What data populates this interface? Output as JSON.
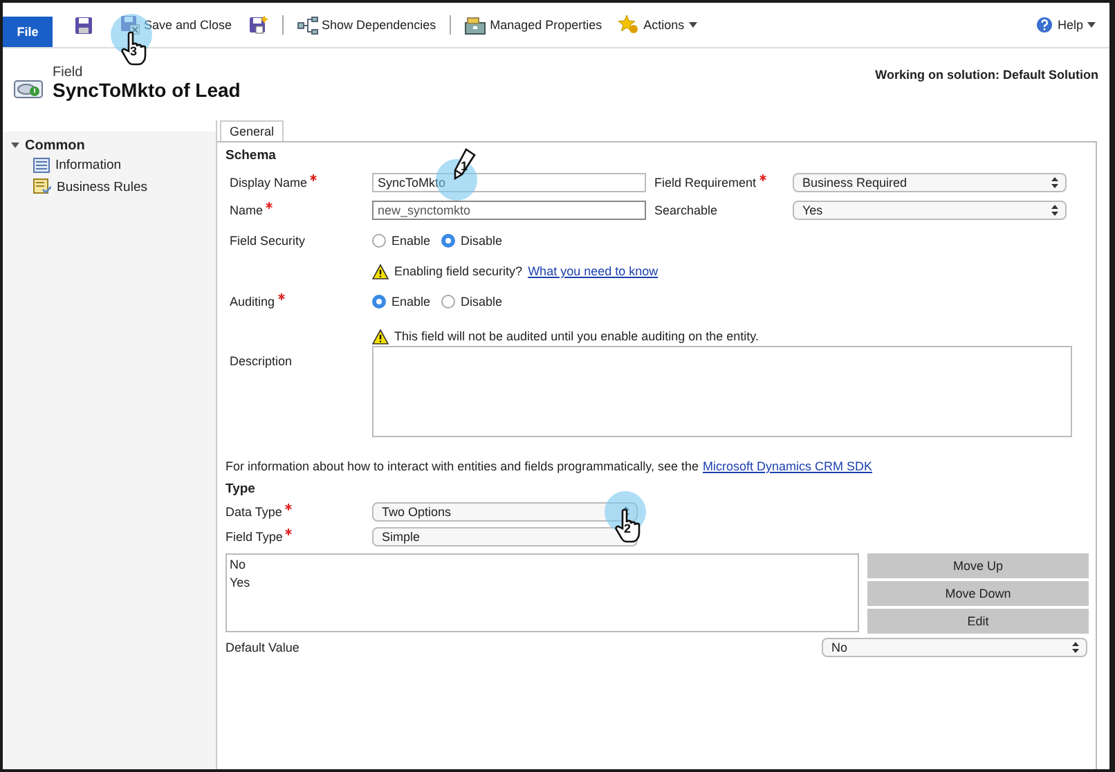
{
  "toolbar": {
    "file_tab": "File",
    "items": [
      {
        "kind": "save"
      },
      {
        "kind": "save_close",
        "label": "Save and Close",
        "callout": {
          "number": "3",
          "kind": "hand"
        }
      },
      {
        "kind": "save_new"
      },
      {
        "kind": "separator"
      },
      {
        "kind": "dependencies",
        "label": "Show Dependencies"
      },
      {
        "kind": "separator"
      },
      {
        "kind": "managed",
        "label": "Managed Properties"
      },
      {
        "kind": "actions",
        "label": "Actions",
        "dropdown": true
      }
    ],
    "help": {
      "label": "Help",
      "dropdown": true
    }
  },
  "header": {
    "entity": "Field",
    "title": "SyncToMkto of Lead",
    "solution": "Working on solution: Default Solution"
  },
  "nav": [
    {
      "label": "Common",
      "expanded": true,
      "children": [
        {
          "label": "Information",
          "kind": "info"
        },
        {
          "label": "Business Rules",
          "kind": "rules"
        }
      ]
    }
  ],
  "tabs": [
    {
      "label": "General",
      "selected": true
    }
  ],
  "schema": {
    "heading": "Schema",
    "display_name": {
      "label": "Display Name",
      "required": true,
      "value": "SyncToMkto",
      "callout": {
        "number": "1",
        "kind": "pencil"
      }
    },
    "field_requirement": {
      "label": "Field Requirement",
      "required": true,
      "value": "Business Required"
    },
    "name": {
      "label": "Name",
      "required": true,
      "value": "new_synctomkto"
    },
    "searchable": {
      "label": "Searchable",
      "required": false,
      "value": "Yes"
    },
    "field_security": {
      "label": "Field Security",
      "required": false,
      "options": [
        {
          "label": "Enable",
          "selected": false
        },
        {
          "label": "Disable",
          "selected": true
        }
      ]
    },
    "field_security_note": {
      "text": "Enabling field security?",
      "link": "What you need to know"
    },
    "auditing": {
      "label": "Auditing",
      "required": true,
      "options": [
        {
          "label": "Enable",
          "selected": true
        },
        {
          "label": "Disable",
          "selected": false
        }
      ]
    },
    "auditing_note": {
      "text": "This field will not be audited until you enable auditing on the entity."
    },
    "description": {
      "label": "Description"
    }
  },
  "sdk_note": {
    "text": "For information about how to interact with entities and fields programmatically, see the",
    "link": "Microsoft Dynamics CRM SDK"
  },
  "type": {
    "heading": "Type",
    "data_type": {
      "label": "Data Type",
      "required": true,
      "value": "Two Options",
      "callout": {
        "number": "2",
        "kind": "hand"
      }
    },
    "field_type": {
      "label": "Field Type",
      "required": true,
      "value": "Simple"
    },
    "options": [
      "No",
      "Yes"
    ],
    "buttons": [
      "Move Up",
      "Move Down",
      "Edit"
    ],
    "default_value": {
      "label": "Default Value",
      "value": "No"
    }
  }
}
